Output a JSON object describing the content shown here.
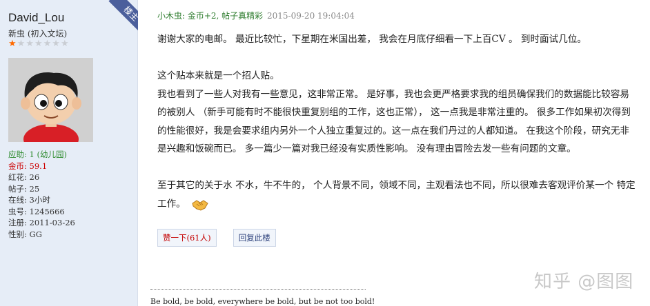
{
  "author": {
    "floor_tag": "楼主",
    "username": "David_Lou",
    "rank_title": "新虫 (初入文坛)",
    "stars_filled": 1,
    "stars_total": 7,
    "stats": {
      "yingzhu": "应助: 1 (幼儿园)",
      "coins": "金币: 59.1",
      "flowers": "红花: 26",
      "posts": "帖子: 25",
      "online": "在线: 3小时",
      "uid": "虫号: 1245666",
      "registered": "注册: 2011-03-26",
      "gender": "性别: GG"
    }
  },
  "post": {
    "meta_user": "小木虫: 金币+2, 帖子真精彩",
    "meta_time": "2015-09-20 19:04:04",
    "lines": [
      "谢谢大家的电邮。 最近比较忙，下星期在米国出差， 我会在月底仔细看一下上百CV 。 到时面试几位。",
      "",
      "这个贴本来就是一个招人贴。",
      "我也看到了一些人对我有一些意见，这非常正常。 是好事，我也会更严格要求我的组员确保我们的数据能比较容易",
      "的被别人 （新手可能有时不能很快重复别组的工作，这也正常）， 这一点我是非常注重的。 很多工作如果初次得到",
      "的性能很好，我是会要求组内另外一个人独立重复过的。这一点在我们丹过的人都知道。 在我这个阶段，研究无非",
      "是兴趣和饭碗而已。 多一篇少一篇对我已经没有实质性影响。 没有理由冒险去发一些有问题的文章。",
      "",
      "至于其它的关于水 不水，牛不牛的， 个人背景不同，领域不同，主观看法也不同，所以很难去客观评价某一个 特定"
    ],
    "last_line": "工作。",
    "like_button": "赞一下(61人)",
    "reply_button": "回复此楼",
    "signature": "Be bold, be bold, everywhere be bold, but be not too bold!"
  },
  "watermark": "知乎 @图图",
  "colors": {
    "sidebar_bg": "#e6edf7",
    "ribbon": "#4b5f9c",
    "meta_green": "#2f7d2f",
    "star_on": "#ff6a00",
    "like_red": "#c40000"
  }
}
